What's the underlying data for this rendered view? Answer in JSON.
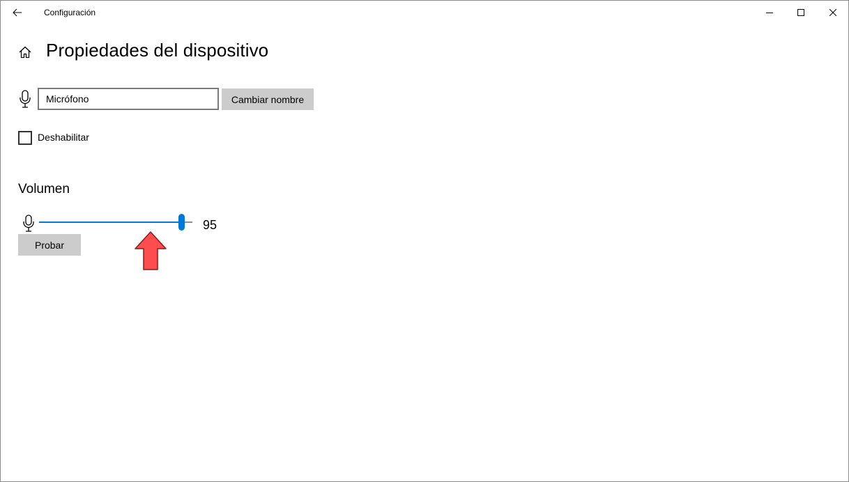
{
  "window": {
    "title": "Configuración"
  },
  "header": {
    "title": "Propiedades del dispositivo"
  },
  "device": {
    "name_value": "Micrófono",
    "rename_label": "Cambiar nombre"
  },
  "disable": {
    "label": "Deshabilitar",
    "checked": false
  },
  "volume": {
    "heading": "Volumen",
    "value": "95",
    "level_percent": 95,
    "test_label": "Probar"
  },
  "colors": {
    "accent": "#0078d7",
    "button_bg": "#cccccc",
    "annotation_arrow": "#ff4d4d"
  },
  "icons": {
    "back": "back-arrow-icon",
    "home": "home-icon",
    "microphone": "microphone-icon",
    "minimize": "minimize-icon",
    "maximize": "maximize-icon",
    "close": "close-icon",
    "annotation": "up-arrow-annotation-icon"
  }
}
